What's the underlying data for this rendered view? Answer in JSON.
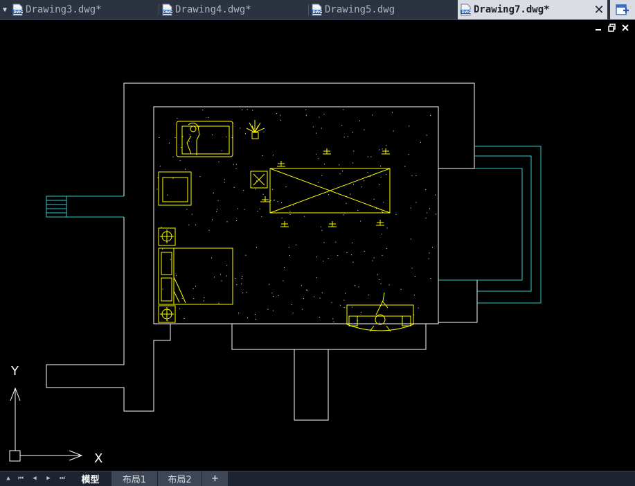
{
  "tabs": [
    {
      "label": "Drawing3.dwg*",
      "active": false
    },
    {
      "label": "Drawing4.dwg*",
      "active": false
    },
    {
      "label": "Drawing5.dwg",
      "active": false
    },
    {
      "label": "Drawing7.dwg*",
      "active": true
    }
  ],
  "tab_icons": {
    "menu": "triangle-down-icon",
    "close": "close-icon",
    "new": "new-tab-icon",
    "file": "dwg-file-icon"
  },
  "window_controls": {
    "minimize": "minimize-icon",
    "restore": "restore-icon",
    "close": "close-icon"
  },
  "ucs": {
    "x_label": "X",
    "y_label": "Y"
  },
  "layout_tabs": [
    {
      "label": "模型",
      "active": true
    },
    {
      "label": "布局1",
      "active": false
    },
    {
      "label": "布局2",
      "active": false
    },
    {
      "label": "+",
      "active": false
    }
  ],
  "nav_buttons": [
    "first-icon",
    "prev-icon",
    "next-icon",
    "last-icon"
  ],
  "colors": {
    "background": "#000000",
    "walls": "#ffffff",
    "furniture": "#ffff00",
    "cyan": "#33cccc",
    "tab_bar": "#2b3240",
    "active_tab": "#d9dde3"
  }
}
